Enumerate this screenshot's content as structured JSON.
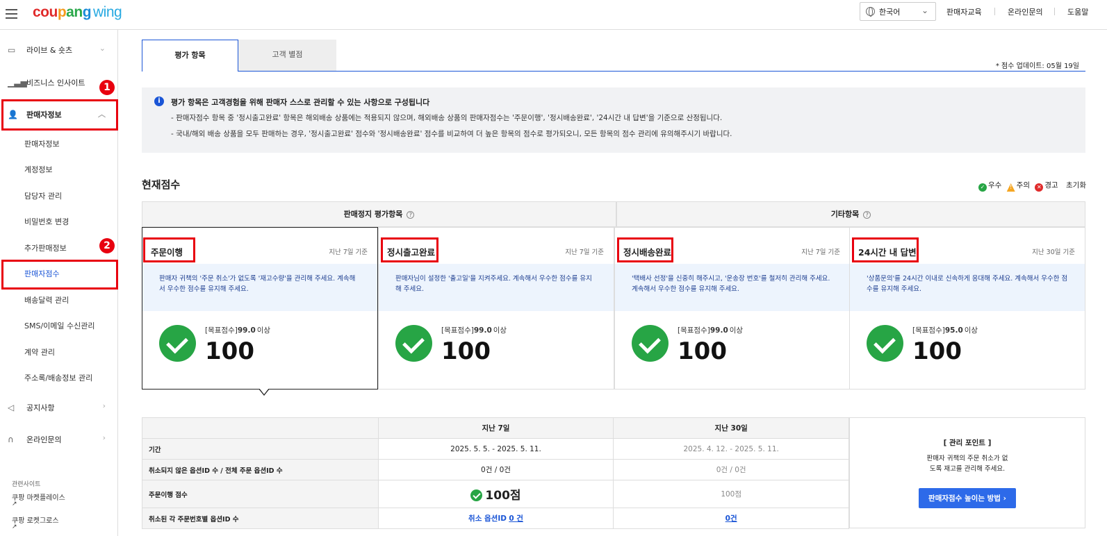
{
  "header": {
    "logo_main": "coupang",
    "logo_sub": "wing",
    "language": "한국어",
    "links": [
      "판매자교육",
      "온라인문의",
      "도움말"
    ]
  },
  "sidebar": {
    "items": [
      {
        "label": "라이브 & 숏츠",
        "icon": "video-icon"
      },
      {
        "label": "비즈니스 인사이트",
        "icon": "chart-icon"
      },
      {
        "label": "판매자정보",
        "icon": "user-icon"
      }
    ],
    "subitems": [
      "판매자정보",
      "계정정보",
      "담당자 관리",
      "비밀번호 변경",
      "추가판매정보",
      "판매자점수",
      "배송달력 관리",
      "SMS/이메일 수신관리",
      "계약 관리",
      "주소록/배송정보 관리"
    ],
    "bottom_items": [
      {
        "label": "공지사항",
        "icon": "megaphone-icon"
      },
      {
        "label": "온라인문의",
        "icon": "headset-icon"
      }
    ],
    "related_title": "관련사이트",
    "related_links": [
      "쿠팡 마켓플레이스",
      "쿠팡 로켓그로스"
    ],
    "badges": [
      "1",
      "2"
    ]
  },
  "tabs": {
    "active": "평가 항목",
    "inactive": "고객 별점"
  },
  "update_text": "* 점수 업데이트: 05월 19일",
  "notice": {
    "title": "평가 항목은 고객경험을 위해 판매자 스스로 관리할 수 있는 사항으로 구성됩니다",
    "line1": "- 판매자점수 항목 중 '정시출고완료' 항목은 해외배송 상품에는 적용되지 않으며, 해외배송 상품의 판매자점수는 '주문이행', '정시배송완료', '24시간 내 답변'을 기준으로 산정됩니다.",
    "line2": "- 국내/해외 배송 상품을 모두 판매하는 경우, '정시출고완료' 점수와 '정시배송완료' 점수를 비교하여 더 높은 항목의 점수로 평가되오니, 모든 항목의 점수 관리에 유의해주시기 바랍니다."
  },
  "current_score": {
    "title": "현재점수",
    "legend": [
      {
        "label": "우수",
        "color": "#27a545"
      },
      {
        "label": "주의",
        "color": "#f5a623"
      },
      {
        "label": "경고",
        "color": "#e02b2b"
      }
    ],
    "reset": "초기화",
    "group1": "판매정지 평가항목",
    "group2": "기타항목"
  },
  "cards": [
    {
      "title": "주문이행",
      "period": "지난 7일 기준",
      "desc": "판매자 귀책의 '주문 취소'가 없도록 '재고수량'을 관리해 주세요. 계속해서 우수한 점수를 유지해 주세요.",
      "target_label": "[목표점수]",
      "target_value": "99.0",
      "target_suffix": "이상",
      "score": "100"
    },
    {
      "title": "정시출고완료",
      "period": "지난 7일 기준",
      "desc": "판매자님이 설정한 '출고일'을 지켜주세요. 계속해서 우수한 점수를 유지해 주세요.",
      "target_label": "[목표점수]",
      "target_value": "99.0",
      "target_suffix": "이상",
      "score": "100"
    },
    {
      "title": "정시배송완료",
      "period": "지난 7일 기준",
      "desc": "'택배사 선정'을 신중히 해주시고, '운송장 번호'를 철저히 관리해 주세요. 계속해서 우수한 점수를 유지해 주세요.",
      "target_label": "[목표점수]",
      "target_value": "99.0",
      "target_suffix": "이상",
      "score": "100"
    },
    {
      "title": "24시간 내 답변",
      "period": "지난 30일 기준",
      "desc": "'상품문의'를 24시간 이내로 신속하게 응대해 주세요. 계속해서 우수한 점수를 유지해 주세요.",
      "target_label": "[목표점수]",
      "target_value": "95.0",
      "target_suffix": "이상",
      "score": "100"
    }
  ],
  "detail_table": {
    "col_headers": [
      "지난 7일",
      "지난 30일"
    ],
    "rows": [
      {
        "label": "기간",
        "v7": "2025. 5. 5. - 2025. 5. 11.",
        "v30": "2025. 4. 12. - 2025. 5. 11."
      },
      {
        "label": "취소되지 않은 옵션ID 수 / 전체 주문 옵션ID 수",
        "v7": "0건 / 0건",
        "v30": "0건 / 0건"
      },
      {
        "label": "주문이행 점수",
        "v7": "100점",
        "v30": "100점"
      },
      {
        "label": "취소된 각 주문번호별 옵션ID 수",
        "v7_prefix": "취소 옵션ID",
        "v7": "0 건",
        "v30": "0건"
      }
    ]
  },
  "management": {
    "title": "[ 관리 포인트 ]",
    "desc1": "판매자 귀책의 주문 취소가 없",
    "desc2": "도록 재고를 관리해 주세요.",
    "button": "판매자점수 높이는 방법"
  }
}
